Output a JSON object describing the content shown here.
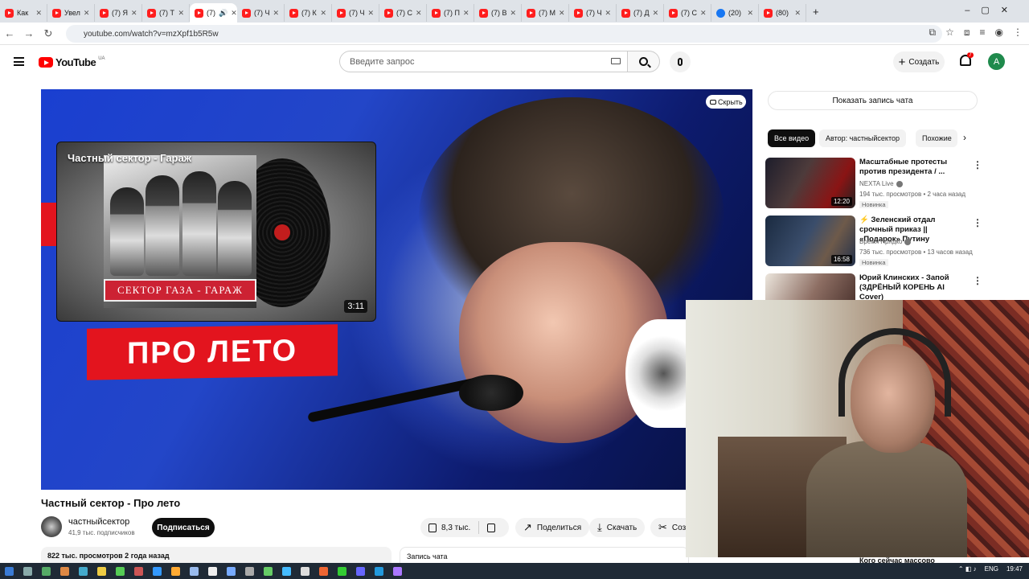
{
  "browser": {
    "tabs": [
      {
        "label": "Как"
      },
      {
        "label": "Увел"
      },
      {
        "label": "(7) Я"
      },
      {
        "label": "(7) Т"
      },
      {
        "label": "(7)"
      },
      {
        "label": "(7) Ч"
      },
      {
        "label": "(7) К"
      },
      {
        "label": "(7) Ч"
      },
      {
        "label": "(7) С"
      },
      {
        "label": "(7) П"
      },
      {
        "label": "(7) В"
      },
      {
        "label": "(7) М"
      },
      {
        "label": "(7) Ч"
      },
      {
        "label": "(7) Д"
      },
      {
        "label": "(7) С"
      },
      {
        "label": "(20)"
      },
      {
        "label": "(80)"
      }
    ],
    "url": "youtube.com/watch?v=mzXpf1b5R5w"
  },
  "header": {
    "logo_text": "YouTube",
    "region": "UA",
    "search_placeholder": "Введите запрос",
    "create_label": "Создать",
    "notifications_count": "7",
    "avatar_letter": "A"
  },
  "player": {
    "hide_label": "Скрыть",
    "endcard_title": "Частный сектор - Гараж",
    "endcard_banner": "СЕКТОР ГАЗА - ГАРАЖ",
    "endcard_duration": "3:11",
    "overlay_text": "ПРО ЛЕТО"
  },
  "video": {
    "title": "Частный сектор - Про лето",
    "channel": "частныйсектор",
    "subscribers": "41,9 тыс. подписчиков",
    "subscribe_label": "Подписаться",
    "likes": "8,3 тыс.",
    "share_label": "Поделиться",
    "download_label": "Скачать",
    "clip_label": "Созд",
    "views_date": "822 тыс. просмотров  2 года назад",
    "chat_replay_label": "Запись чата"
  },
  "sidebar": {
    "show_chat_label": "Показать запись чата",
    "chips": [
      "Все видео",
      "Автор: частныйсектор",
      "Похожие"
    ],
    "recommendations": [
      {
        "title": "Масштабные протесты против президента / ...",
        "channel": "NEXTA Live",
        "meta": "194 тыс. просмотров • 2 часа назад",
        "badge": "Новинка",
        "duration": "12:20"
      },
      {
        "title": "⚡ Зеленский отдал срочный приказ || «Подарок» Путину",
        "channel": "Время Прядко",
        "meta": "736 тыс. просмотров • 13 часов назад",
        "badge": "Новинка",
        "duration": "16:58"
      },
      {
        "title": "Юрий Клинских - Запой (ЗДРЁНЫЙ КОРЕНЬ AI Cover)",
        "channel": "",
        "meta": "",
        "badge": "",
        "duration": ""
      }
    ],
    "bottom_peek": "Кого сейчас массово"
  },
  "taskbar": {
    "lang": "ENG",
    "time": "19:47"
  },
  "colors": {
    "yt_red": "#ff0000",
    "text_primary": "#0f0f0f",
    "text_secondary": "#606060",
    "chip_bg": "#f2f2f2"
  }
}
